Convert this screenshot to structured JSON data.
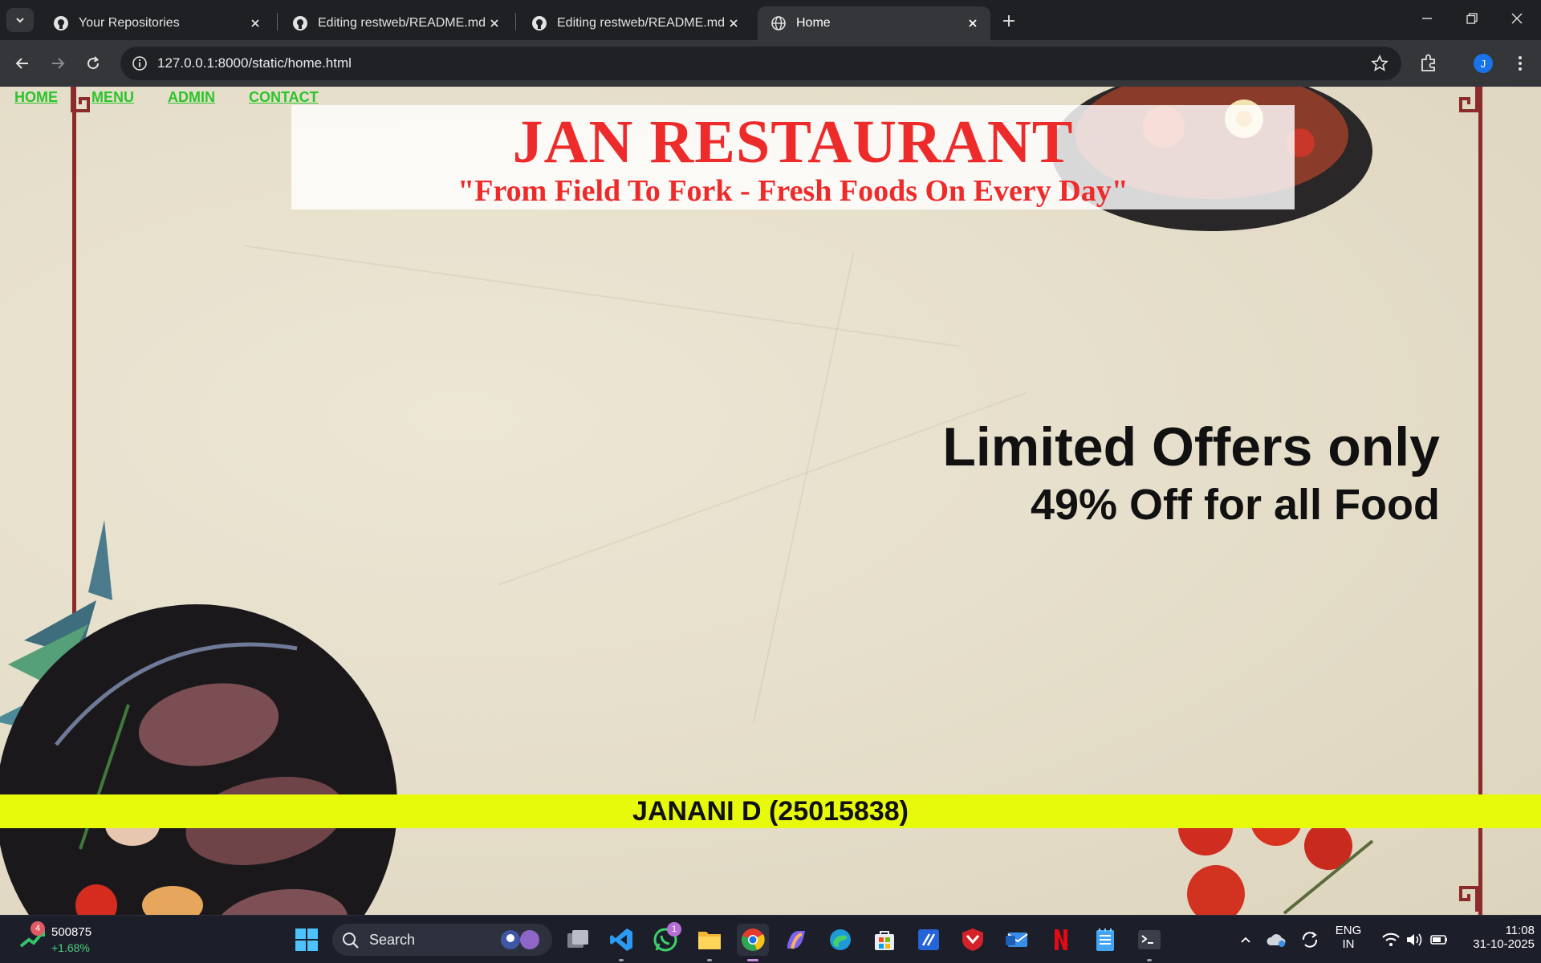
{
  "browser": {
    "tabs": [
      {
        "title": "Your Repositories",
        "active": false
      },
      {
        "title": "Editing restweb/README.md at",
        "active": false
      },
      {
        "title": "Editing restweb/README.md at",
        "active": false
      },
      {
        "title": "Home",
        "active": true
      }
    ],
    "url": "127.0.0.1:8000/static/home.html",
    "profile_initial": "J"
  },
  "page": {
    "nav": [
      "HOME",
      "MENU",
      "ADMIN",
      "CONTACT"
    ],
    "title": "JAN RESTAURANT",
    "tagline": "\"From Field To Fork - Fresh Foods On Every Day\"",
    "offer_line1": "Limited Offers only",
    "offer_line2": "49% Off for all Food",
    "footer": "JANANI D (25015838)",
    "colors": {
      "title": "#ee2b2b",
      "nav": "#2bc42b",
      "footer_bg": "#e8fa0b",
      "border": "#8b2b2b"
    }
  },
  "taskbar": {
    "stock_badge": "4",
    "stock_value": "500875",
    "stock_change": "+1.68%",
    "search_label": "Search",
    "whatsapp_badge": "1",
    "lang_top": "ENG",
    "lang_bottom": "IN",
    "time": "11:08",
    "date": "31-10-2025"
  }
}
